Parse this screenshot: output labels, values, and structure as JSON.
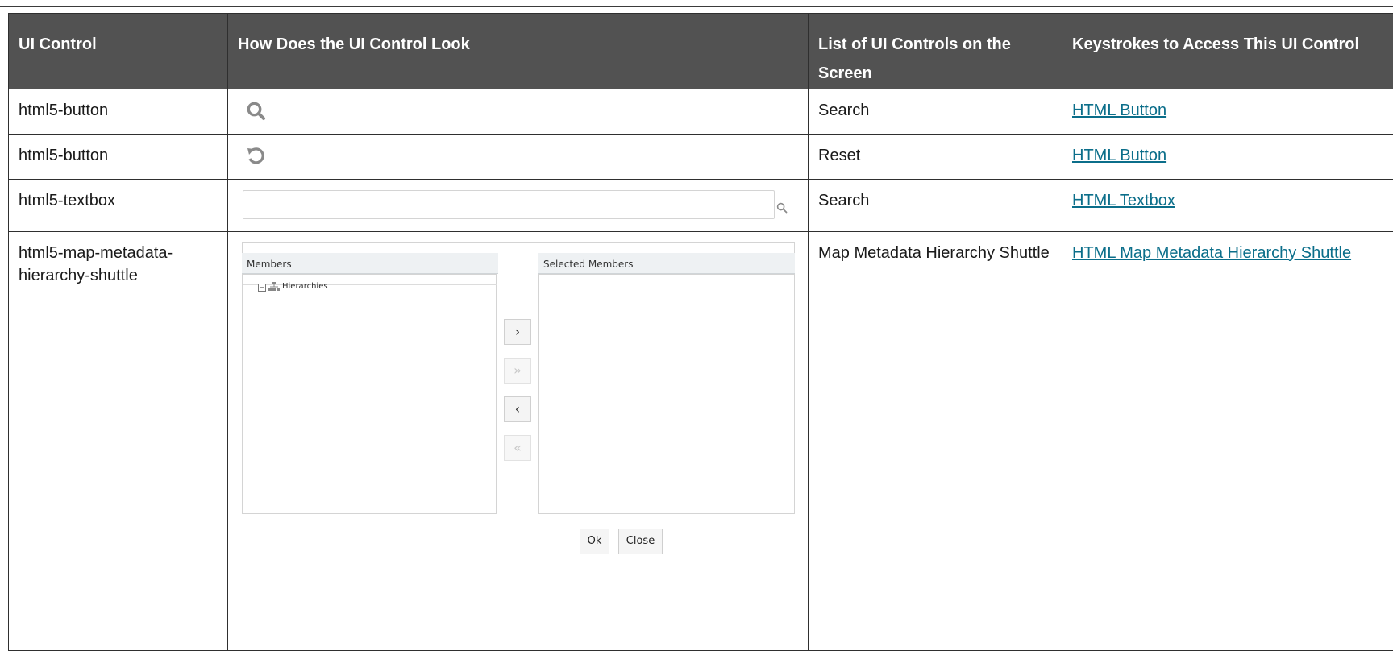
{
  "table": {
    "headers": [
      "UI Control",
      "How Does the UI Control Look",
      "List of UI Controls on the Screen",
      "Keystrokes to Access This UI Control"
    ],
    "rows": [
      {
        "control": "html5-button",
        "look_icon": "search-icon",
        "list": "Search",
        "keystroke": "HTML Button"
      },
      {
        "control": "html5-button",
        "look_icon": "reset-icon",
        "list": "Reset",
        "keystroke": "HTML Button"
      },
      {
        "control": "html5-textbox",
        "look_icon": "search-icon",
        "list": "Search",
        "keystroke": "HTML Textbox"
      },
      {
        "control": "html5-map-metadata-hierarchy-shuttle",
        "list": "Map Metadata Hierarchy Shuttle",
        "keystroke": "HTML Map Metadata Hierarchy Shuttle"
      }
    ]
  },
  "shuttle": {
    "members_label": "Members",
    "selected_label": "Selected Members",
    "tree_item": "Hierarchies",
    "move_right": "›",
    "move_all_right": "»",
    "move_left": "‹",
    "move_all_left": "«",
    "ok_label": "Ok",
    "close_label": "Close"
  },
  "colors": {
    "header_bg": "#525252",
    "link": "#0b6e8a",
    "icon_gray": "#8a8a8a"
  }
}
